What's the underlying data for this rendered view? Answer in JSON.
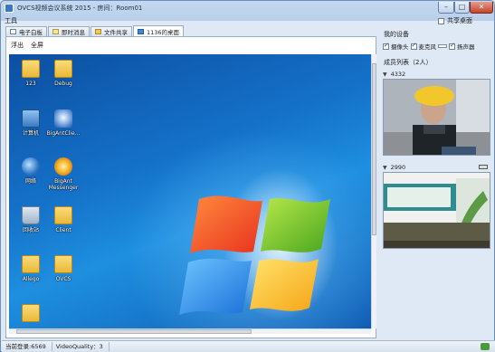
{
  "window": {
    "title": "OVCS视频会议系统 2015 - 房间：Room01",
    "minimize_glyph": "–",
    "maximize_glyph": "□",
    "close_glyph": "✕"
  },
  "menu": {
    "tools_label": "工具"
  },
  "share_desktop": {
    "label": "共享桌面",
    "checked": false
  },
  "tabs": [
    {
      "label": "电子白板",
      "icon": "whiteboard-icon"
    },
    {
      "label": "即时消息",
      "icon": "message-icon"
    },
    {
      "label": "文件共享",
      "icon": "folder-icon"
    },
    {
      "label": "1136的桌面",
      "icon": "desktop-icon",
      "active": true
    }
  ],
  "viewbar": {
    "detach_label": "浮出",
    "fullscreen_label": "全屏"
  },
  "desktop_icons": [
    {
      "label": "123",
      "icon": "folder-icon"
    },
    {
      "label": "Debug",
      "icon": "folder-icon"
    },
    {
      "label": "计算机",
      "icon": "computer-icon"
    },
    {
      "label": "BigAntClie...",
      "icon": "bigant-client-icon"
    },
    {
      "label": "网络",
      "icon": "network-icon"
    },
    {
      "label": "BigAnt\nMessenger",
      "icon": "bigant-messenger-icon"
    },
    {
      "label": "回收站",
      "icon": "recycle-bin-icon"
    },
    {
      "label": "Client",
      "icon": "folder-icon"
    },
    {
      "label": "Allego",
      "icon": "folder-icon"
    },
    {
      "label": "OVCS",
      "icon": "folder-icon"
    }
  ],
  "my_devices": {
    "title": "我的设备",
    "camera_label": "摄像头",
    "mic_label": "麦克风",
    "speaker_label": "扬声器"
  },
  "members": {
    "title": "成员列表（2人）",
    "list": [
      {
        "id": "4332"
      },
      {
        "id": "2990"
      }
    ]
  },
  "statusbar": {
    "login": "当前登录:6569",
    "quality": "VideoQuality：3"
  },
  "colors": {
    "accent": "#3a77c9",
    "desktop_blue": "#1572c9"
  }
}
